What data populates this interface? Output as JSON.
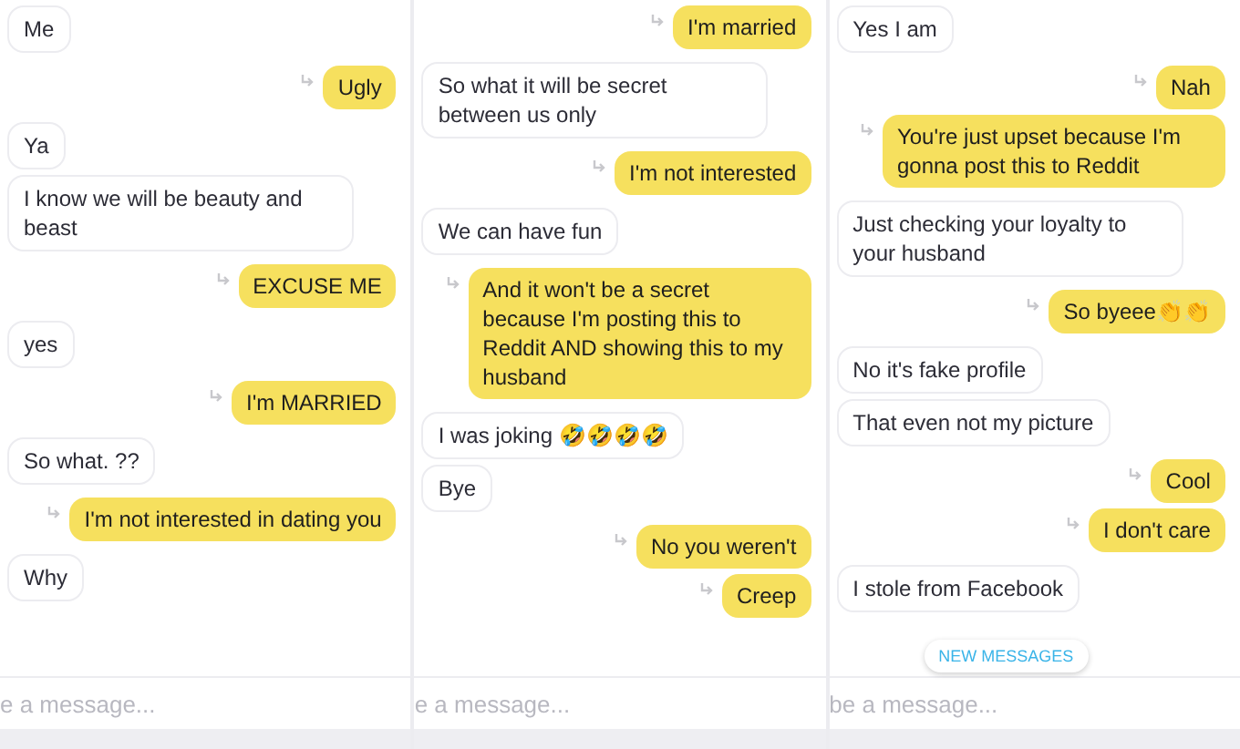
{
  "panels": [
    {
      "messages": [
        {
          "text": "Me",
          "sent": false
        },
        {
          "text": "Ugly",
          "sent": true
        },
        {
          "text": "Ya",
          "sent": false
        },
        {
          "text": "I know we will be beauty and beast",
          "sent": false
        },
        {
          "text": "EXCUSE ME",
          "sent": true
        },
        {
          "text": "yes",
          "sent": false
        },
        {
          "text": "I'm MARRIED",
          "sent": true
        },
        {
          "text": "So what. ??",
          "sent": false
        },
        {
          "text": "I'm not interested in dating you",
          "sent": true
        },
        {
          "text": "Why",
          "sent": false
        }
      ],
      "placeholder": "e a message..."
    },
    {
      "messages": [
        {
          "text": "I'm married",
          "sent": true
        },
        {
          "text": "So what it will be secret between us only",
          "sent": false
        },
        {
          "text": "I'm not interested",
          "sent": true
        },
        {
          "text": "We can have fun",
          "sent": false
        },
        {
          "text": "And it won't be a secret because I'm posting this to Reddit AND showing this to my husband",
          "sent": true
        },
        {
          "text": "I was joking 🤣🤣🤣🤣",
          "sent": false
        },
        {
          "text": "Bye",
          "sent": false
        },
        {
          "text": "No you weren't",
          "sent": true
        },
        {
          "text": "Creep",
          "sent": true
        }
      ],
      "placeholder": "e a message..."
    },
    {
      "messages": [
        {
          "text": "Yes I am",
          "sent": false
        },
        {
          "text": "Nah",
          "sent": true
        },
        {
          "text": "You're just upset because I'm gonna post this to Reddit",
          "sent": true
        },
        {
          "text": "Just checking your loyalty to your husband",
          "sent": false
        },
        {
          "text": "So byeee👏👏",
          "sent": true
        },
        {
          "text": "No it's fake profile",
          "sent": false
        },
        {
          "text": "That even not my picture",
          "sent": false
        },
        {
          "text": "Cool",
          "sent": true
        },
        {
          "text": "I don't care",
          "sent": true
        },
        {
          "text": "I stole from Facebook",
          "sent": false
        }
      ],
      "placeholder": "be a message...",
      "badge": "NEW MESSAGES"
    }
  ]
}
